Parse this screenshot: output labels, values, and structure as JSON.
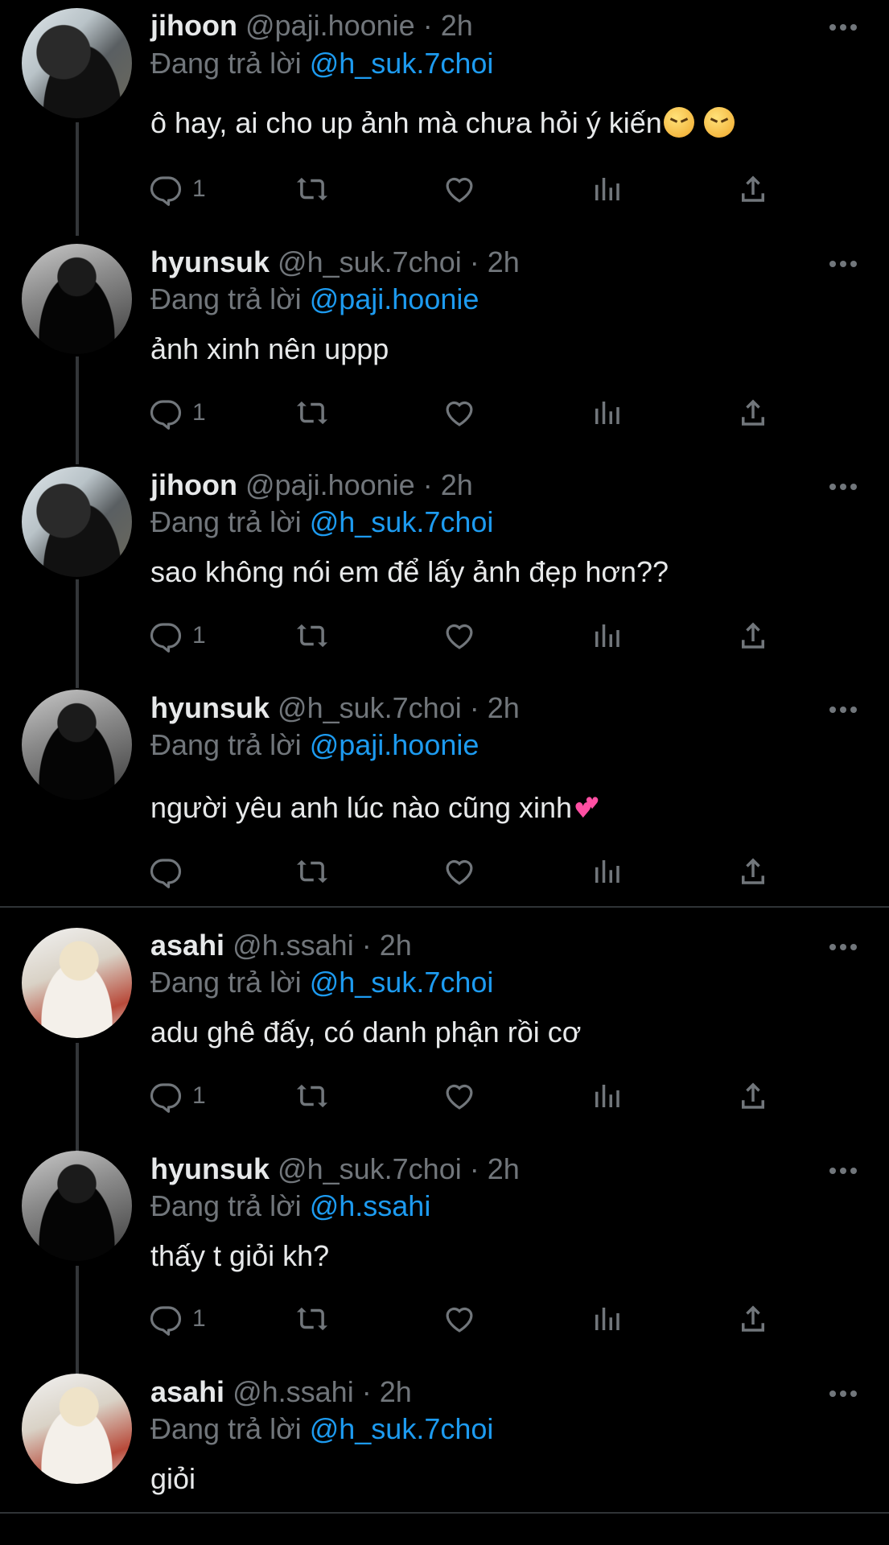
{
  "tweets": [
    {
      "name": "jihoon",
      "handle": "@paji.hoonie",
      "time": "· 2h",
      "reply_prefix": "Đang trả lời",
      "reply_to": "@h_suk.7choi",
      "text": "ô hay, ai cho up ảnh mà chưa hỏi ý kiến",
      "emoji_after": "angry-face-emoji ×2",
      "reply_count": "1",
      "avatar": "jihoon-avatar"
    },
    {
      "name": "hyunsuk",
      "handle": "@h_suk.7choi",
      "time": "· 2h",
      "reply_prefix": "Đang trả lời",
      "reply_to": "@paji.hoonie",
      "text": "ảnh xinh nên uppp",
      "reply_count": "1",
      "avatar": "hyunsuk-avatar"
    },
    {
      "name": "jihoon",
      "handle": "@paji.hoonie",
      "time": "· 2h",
      "reply_prefix": "Đang trả lời",
      "reply_to": "@h_suk.7choi",
      "text": "sao không nói em để lấy ảnh đẹp hơn??",
      "reply_count": "1",
      "avatar": "jihoon-avatar"
    },
    {
      "name": "hyunsuk",
      "handle": "@h_suk.7choi",
      "time": "· 2h",
      "reply_prefix": "Đang trả lời",
      "reply_to": "@paji.hoonie",
      "text": "người yêu anh lúc nào cũng xinh",
      "emoji_after": "two-hearts-emoji",
      "reply_count": "",
      "avatar": "hyunsuk-avatar"
    },
    {
      "name": "asahi",
      "handle": "@h.ssahi",
      "time": "· 2h",
      "reply_prefix": "Đang trả lời",
      "reply_to": "@h_suk.7choi",
      "text": "adu ghê đấy, có danh phận rồi cơ",
      "reply_count": "1",
      "avatar": "asahi-avatar"
    },
    {
      "name": "hyunsuk",
      "handle": "@h_suk.7choi",
      "time": "· 2h",
      "reply_prefix": "Đang trả lời",
      "reply_to": "@h.ssahi",
      "text": "thấy t giỏi kh?",
      "reply_count": "1",
      "avatar": "hyunsuk-avatar"
    },
    {
      "name": "asahi",
      "handle": "@h.ssahi",
      "time": "· 2h",
      "reply_prefix": "Đang trả lời",
      "reply_to": "@h_suk.7choi",
      "text": "giỏi",
      "reply_count": "",
      "avatar": "asahi-avatar"
    }
  ],
  "icons": [
    "reply-icon",
    "retweet-icon",
    "like-icon",
    "views-icon",
    "share-icon",
    "more-icon"
  ],
  "colors": {
    "background": "#000000",
    "text": "#e7e9ea",
    "muted": "#71767b",
    "mention": "#1d9bf0",
    "divider": "#2f3336"
  }
}
